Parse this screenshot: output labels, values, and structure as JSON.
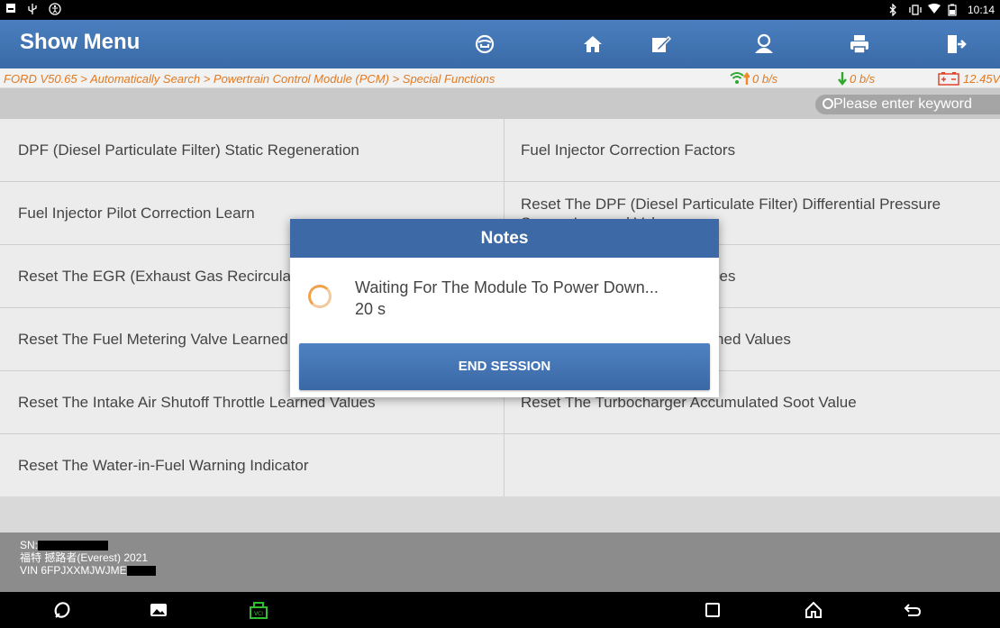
{
  "status_bar": {
    "time": "10:14",
    "left_icons": [
      "notification-icon",
      "usb-icon",
      "accessibility-icon"
    ],
    "right_icons": [
      "bluetooth-icon",
      "vibrate-icon",
      "wifi-icon",
      "battery-icon"
    ]
  },
  "header": {
    "title": "Show Menu",
    "toolbar": [
      "vehicle-icon",
      "home-icon",
      "report-icon",
      "user-icon",
      "print-icon",
      "exit-icon"
    ]
  },
  "breadcrumb": {
    "path": "FORD V50.65 > Automatically Search > Powertrain Control Module (PCM) > Special Functions",
    "upload": "0 b/s",
    "download": "0 b/s",
    "voltage": "12.45V"
  },
  "search": {
    "placeholder": "Please enter keyword"
  },
  "functions": {
    "left": [
      "DPF (Diesel Particulate Filter) Static Regeneration",
      "Fuel Injector Pilot Correction Learn",
      "Reset The EGR (Exhaust Gas Recirculation) Learned Values",
      "Reset The Fuel Metering Valve Learned Values",
      "Reset The Intake Air Shutoff Throttle Learned Values",
      "Reset The Water-in-Fuel Warning Indicator"
    ],
    "right": [
      "Fuel Injector Correction Factors",
      "Reset The DPF (Diesel Particulate Filter) Differential Pressure Sensor Learned Values",
      "Reset The Fuel Learned Values",
      "Reset The Fuel System Learned Values",
      "Reset The Turbocharger Accumulated Soot Value",
      ""
    ]
  },
  "vehicle_info": {
    "sn_label": "SN:",
    "model": "福特 撼路者(Everest) 2021",
    "vin_label": "VIN 6FPJXXMJWJME"
  },
  "dialog": {
    "title": "Notes",
    "message": "Waiting For The Module To Power Down...",
    "countdown": "20 s",
    "button": "END SESSION"
  },
  "nav_bar": [
    "browser-icon",
    "gallery-icon",
    "vci-icon",
    "recent-apps-icon",
    "home-nav-icon",
    "back-icon"
  ],
  "colors": {
    "header": "#3d6aa6",
    "breadcrumb_text": "#e07a23",
    "status_green": "#2ea82e",
    "status_orange": "#f08a24"
  }
}
